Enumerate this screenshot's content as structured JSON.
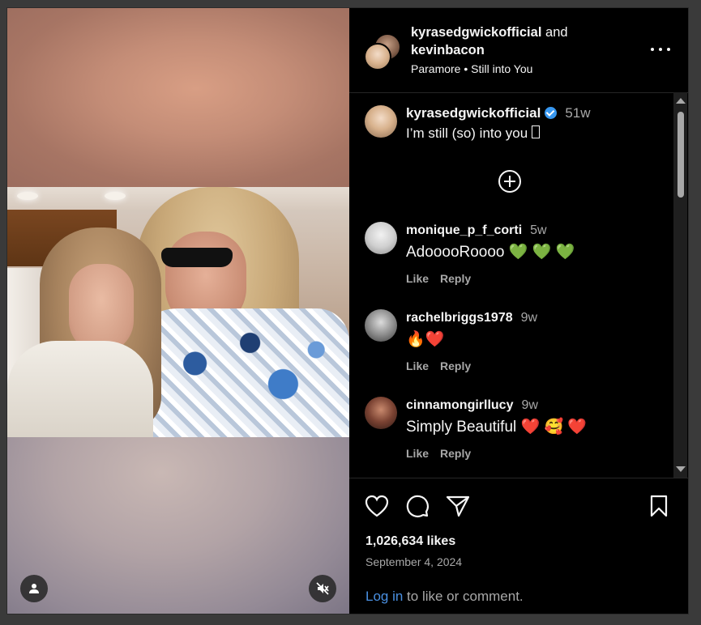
{
  "header": {
    "user1": "kyrasedgwickofficial",
    "and": "and",
    "user2": "kevinbacon",
    "audio": "Paramore • Still into You"
  },
  "caption": {
    "username": "kyrasedgwickofficial",
    "time": "51w",
    "text": "I’m still (so) into you ",
    "icon": "missing-glyph"
  },
  "comments": [
    {
      "username": "monique_p_f_corti",
      "time": "5w",
      "text": "AdooooRoooo 💚 💚 💚",
      "like": "Like",
      "reply": "Reply"
    },
    {
      "username": "rachelbriggs1978",
      "time": "9w",
      "text": "🔥❤️",
      "like": "Like",
      "reply": "Reply"
    },
    {
      "username": "cinnamongirllucy",
      "time": "9w",
      "text": "Simply Beautiful ❤️ 🥰 ❤️",
      "like": "Like",
      "reply": "Reply"
    }
  ],
  "footer": {
    "likes": "1,026,634 likes",
    "date": "September 4, 2024",
    "login_link": "Log in",
    "login_rest": " to like or comment."
  },
  "colors": {
    "background": "#000000",
    "text": "#f5f5f5",
    "secondary": "#a8a8a8",
    "link": "#4a90e2",
    "verified": "#3797f0"
  }
}
